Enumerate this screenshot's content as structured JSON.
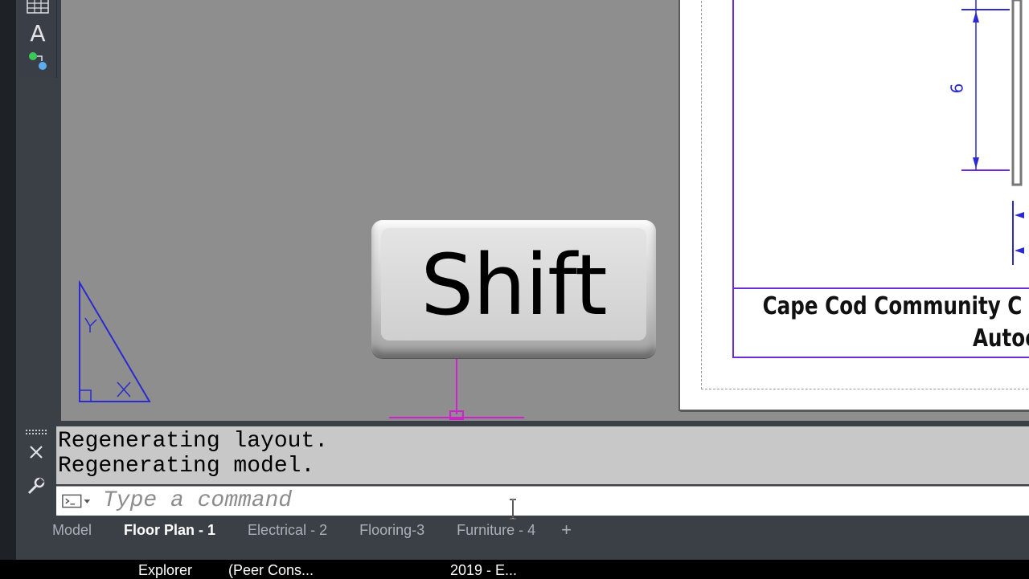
{
  "palette": {
    "tools": [
      {
        "icon": "table-icon"
      },
      {
        "icon": "text-icon",
        "glyph": "A"
      },
      {
        "icon": "parameters-icon"
      }
    ]
  },
  "drawing": {
    "title_block": {
      "line1": "Cape Cod Community C",
      "line2": "Autocad"
    },
    "dimension_text": "6",
    "colors": {
      "border": "#6b2bd9",
      "dimension": "#2a2ad0",
      "ucs": "#d020d0"
    }
  },
  "overlay": {
    "key_label": "Shift"
  },
  "command": {
    "history": [
      "Regenerating layout.",
      "Regenerating model."
    ],
    "placeholder": "Type a command"
  },
  "tabs": [
    {
      "label": "Model",
      "active": false
    },
    {
      "label": "Floor Plan - 1",
      "active": true
    },
    {
      "label": "Electrical - 2",
      "active": false
    },
    {
      "label": "Flooring-3",
      "active": false
    },
    {
      "label": "Furniture - 4",
      "active": false
    }
  ],
  "tab_add_label": "+",
  "taskbar": {
    "items": [
      "Explorer",
      "(Peer Cons...",
      "2019 - E..."
    ]
  }
}
